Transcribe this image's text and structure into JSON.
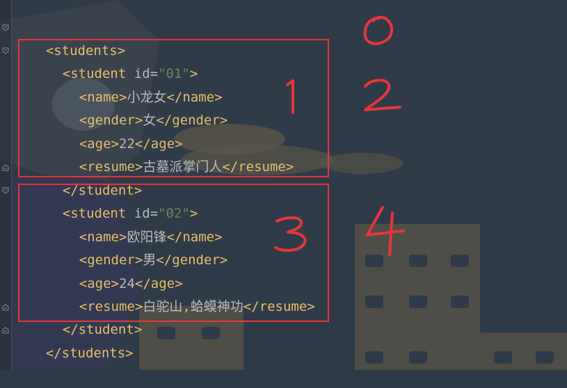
{
  "editor": {
    "lines": [
      {
        "indent": 0,
        "open_tag": "students",
        "type": "open"
      },
      {
        "indent": 1,
        "open_tag": "student",
        "attr_name": "id",
        "attr_value": "\"01\"",
        "type": "open_attr"
      },
      {
        "indent": 2,
        "tag": "name",
        "text": "小龙女",
        "type": "leaf"
      },
      {
        "indent": 2,
        "tag": "gender",
        "text": "女",
        "type": "leaf"
      },
      {
        "indent": 2,
        "tag": "age",
        "text": "22",
        "type": "leaf"
      },
      {
        "indent": 2,
        "tag": "resume",
        "text": "古墓派掌门人",
        "type": "leaf"
      },
      {
        "indent": 1,
        "close_tag": "student",
        "type": "close"
      },
      {
        "indent": 1,
        "open_tag": "student",
        "attr_name": "id",
        "attr_value": "\"02\"",
        "type": "open_attr"
      },
      {
        "indent": 2,
        "tag": "name",
        "text": "欧阳锋",
        "type": "leaf"
      },
      {
        "indent": 2,
        "tag": "gender",
        "text": "男",
        "type": "leaf"
      },
      {
        "indent": 2,
        "tag": "age",
        "text": "24",
        "type": "leaf"
      },
      {
        "indent": 2,
        "tag": "resume",
        "text": "白驼山,蛤蟆神功",
        "type": "leaf"
      },
      {
        "indent": 1,
        "close_tag": "student",
        "type": "close"
      },
      {
        "indent": 0,
        "close_tag": "students",
        "type": "close"
      }
    ]
  },
  "annotations": {
    "labels": [
      "0",
      "1",
      "2",
      "3",
      "4"
    ],
    "color": "#e8353a"
  },
  "colors": {
    "tag": "#e8bf6a",
    "attr_value": "#6a8759",
    "text": "#bbbbbb",
    "annotation": "#e8353a"
  }
}
